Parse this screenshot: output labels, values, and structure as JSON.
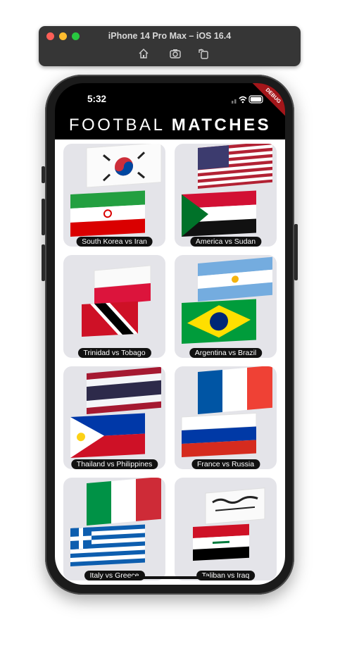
{
  "simulator": {
    "title": "iPhone 14 Pro Max – iOS 16.4",
    "tools": [
      "home-icon",
      "screenshot-icon",
      "rotate-icon"
    ]
  },
  "status": {
    "time": "5:32",
    "debug": "DEBUG"
  },
  "app": {
    "title_light": "FOOTBAL",
    "title_bold": "MATCHES"
  },
  "matches": [
    {
      "label": "South Korea vs Iran"
    },
    {
      "label": "America vs Sudan"
    },
    {
      "label": "Trinidad vs Tobago"
    },
    {
      "label": "Argentina vs Brazil"
    },
    {
      "label": "Thailand vs Philippines"
    },
    {
      "label": "France vs Russia"
    },
    {
      "label": "Italy vs Greece"
    },
    {
      "label": "Taliban vs Iraq"
    }
  ]
}
